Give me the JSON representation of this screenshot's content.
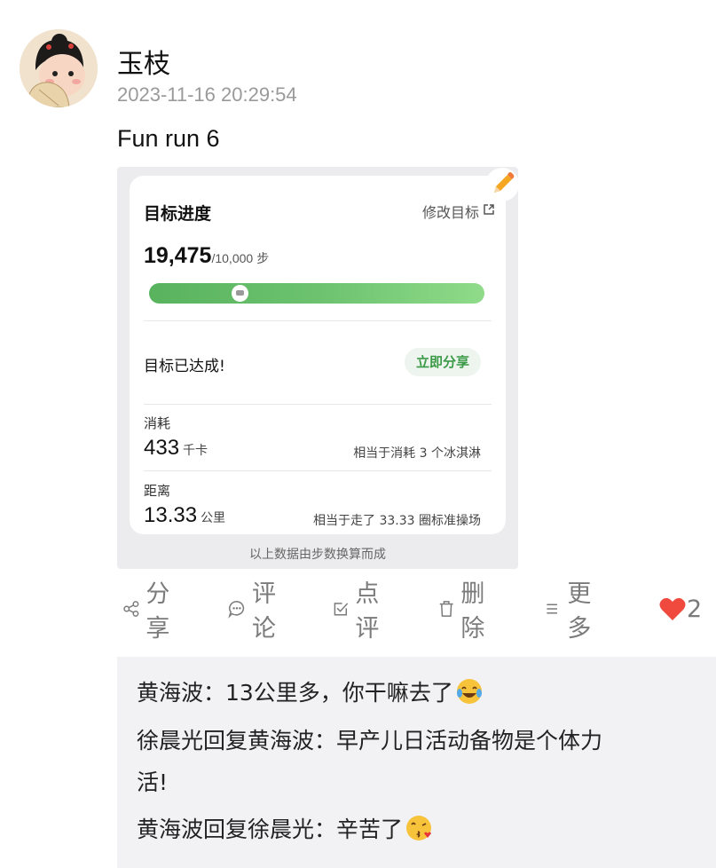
{
  "post": {
    "author": "玉枝",
    "timestamp": "2023-11-16 20:29:54",
    "text": "Fun run 6"
  },
  "health_card": {
    "title": "目标进度",
    "edit_label": "修改目标",
    "steps_value": "19,475",
    "steps_goal": "/10,000",
    "steps_unit": "步",
    "progress_fraction": 1.0,
    "goal_status": "目标已达成!",
    "share_label": "立即分享",
    "calories": {
      "label": "消耗",
      "value": "433",
      "unit": "千卡",
      "equivalent": "相当于消耗 3 个冰淇淋"
    },
    "distance": {
      "label": "距离",
      "value": "13.33",
      "unit": "公里",
      "equivalent": "相当于走了 33.33 圈标准操场"
    },
    "footnote": "以上数据由步数换算而成"
  },
  "actions": {
    "share": "分享",
    "comment": "评论",
    "review": "点评",
    "delete": "删除",
    "more": "更多",
    "like_count": "2"
  },
  "comments": [
    {
      "text": "黄海波：13公里多，你干嘛去了",
      "emoji": "laughing-tears"
    },
    {
      "text": "徐晨光回复黄海波：早产儿日活动备物是个体力",
      "emoji": ""
    },
    {
      "text": "活!",
      "emoji": ""
    },
    {
      "text": "黄海波回复徐晨光：辛苦了",
      "emoji": "kiss"
    }
  ],
  "colors": {
    "accent_green": "#59b35e",
    "like_red": "#f04a3e",
    "meta_gray": "#9a9a9a"
  }
}
